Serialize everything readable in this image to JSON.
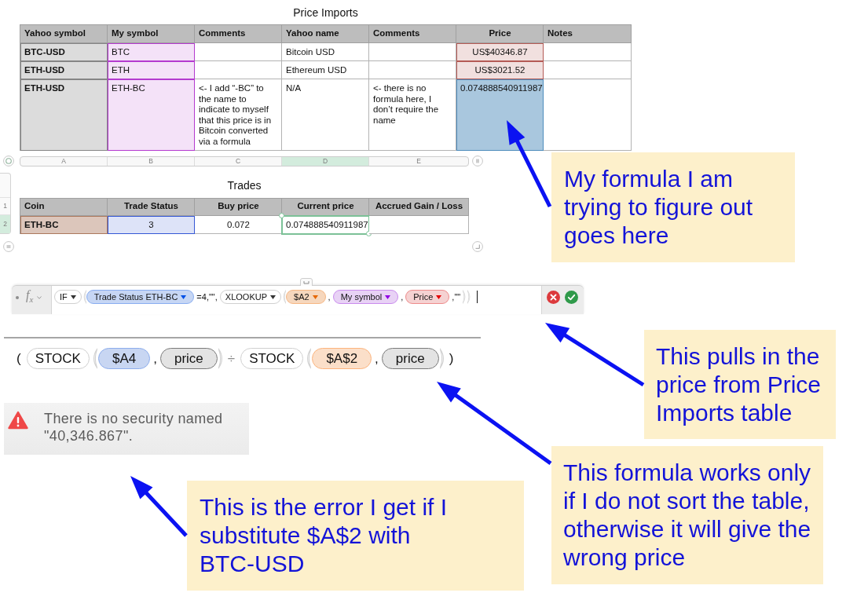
{
  "price_imports": {
    "title": "Price Imports",
    "columns": [
      "Yahoo symbol",
      "My symbol",
      "Comments",
      "Yahoo name",
      "Comments",
      "Price",
      "Notes"
    ],
    "rows": [
      [
        {
          "text": "BTC-USD",
          "color": "#dcdcdc"
        },
        {
          "text": "BTC",
          "color": "#f4e2f8"
        },
        null,
        {
          "text": "Bitcoin USD"
        },
        null,
        {
          "text": "US$40346.87",
          "color": "#f1e0df"
        },
        null
      ],
      [
        {
          "text": "ETH-USD",
          "color": "#dcdcdc"
        },
        {
          "text": "ETH",
          "color": "#f4e2f8"
        },
        null,
        {
          "text": "Ethereum USD"
        },
        null,
        {
          "text": "US$3021.52",
          "color": "#f1e0df"
        },
        null
      ],
      [
        {
          "text": "ETH-USD",
          "color": "#dcdcdc"
        },
        {
          "text": "ETH-BC",
          "color": "#f4e2f8"
        },
        {
          "text": "<- I add “-BC” to the name to indicate to myself that this price is in Bitcoin converted via a formula"
        },
        {
          "text": "N/A"
        },
        {
          "text": "<- there is no formula here, I don’t require the name"
        },
        {
          "text": "0.074888540911987",
          "color": "#a9c7de"
        },
        null
      ]
    ]
  },
  "column_ruler": [
    {
      "label": "A",
      "selected": false
    },
    {
      "label": "B",
      "selected": false
    },
    {
      "label": "C",
      "selected": false
    },
    {
      "label": "D",
      "selected": true
    },
    {
      "label": "E",
      "selected": false
    }
  ],
  "trades": {
    "title": "Trades",
    "row_headers": [
      {
        "label": "1",
        "selected": false
      },
      {
        "label": "2",
        "selected": true
      }
    ],
    "columns": [
      "Coin",
      "Trade Status",
      "Buy price",
      "Current price",
      "Accrued Gain / Loss"
    ],
    "rows": [
      [
        {
          "text": "ETH-BC",
          "color": "#dcc6bb",
          "selected": false
        },
        {
          "text": "3",
          "color": "#dde3f8",
          "selected": false
        },
        {
          "text": "0.072",
          "selected": false
        },
        {
          "text": "0.074888540911987",
          "selected": true
        },
        {
          "selected": false
        }
      ]
    ]
  },
  "formula_bar": {
    "function_label": "f$_{x}$",
    "dropdowns": true,
    "tokens": [
      {
        "kind": "function",
        "text": "IF",
        "args": [
          {
            "kind": "reference",
            "text": "Trade Status ETH-BC",
            "color": "#c6d6f4"
          },
          {
            "kind": "text",
            "text": "=4,\"\","
          },
          {
            "kind": "function",
            "text": "XLOOKUP",
            "args": [
              {
                "kind": "reference",
                "text": "$A2",
                "color": "#f6d7bd"
              },
              {
                "kind": "text",
                "text": ","
              },
              {
                "kind": "reference",
                "text": "My symbol",
                "color": "#e8d2f5"
              },
              {
                "kind": "text",
                "text": ","
              },
              {
                "kind": "reference",
                "text": "Price",
                "color": "#f5d2d2"
              },
              {
                "kind": "text",
                "text": ",\"\""
              }
            ]
          }
        ]
      }
    ]
  },
  "stock_formula": {
    "tokens": [
      {
        "kind": "text",
        "text": "("
      },
      {
        "kind": "function",
        "text": "STOCK",
        "args": [
          {
            "kind": "reference",
            "text": "$A4",
            "color": "#c8d6f2"
          },
          {
            "kind": "text",
            "text": ","
          },
          {
            "kind": "value",
            "text": "price"
          }
        ]
      },
      {
        "kind": "operator",
        "text": "÷"
      },
      {
        "kind": "function",
        "text": "STOCK",
        "args": [
          {
            "kind": "reference",
            "text": "$A$2",
            "color": "#fbdfc9"
          },
          {
            "kind": "text",
            "text": ","
          },
          {
            "kind": "value",
            "text": "price"
          }
        ]
      },
      {
        "kind": "text",
        "text": ")"
      }
    ]
  },
  "error": {
    "message": "There is no security named \"40,346.867\"."
  },
  "callouts": [
    {
      "text": "My formula I am trying to figure out goes here"
    },
    {
      "text": "This pulls in the price from Price Imports table"
    },
    {
      "text": "This is the error I get if I substitute $A$2 with BTC-USD"
    },
    {
      "text": "This formula works only if I do not sort the table, otherwise it will give the wrong price"
    }
  ]
}
